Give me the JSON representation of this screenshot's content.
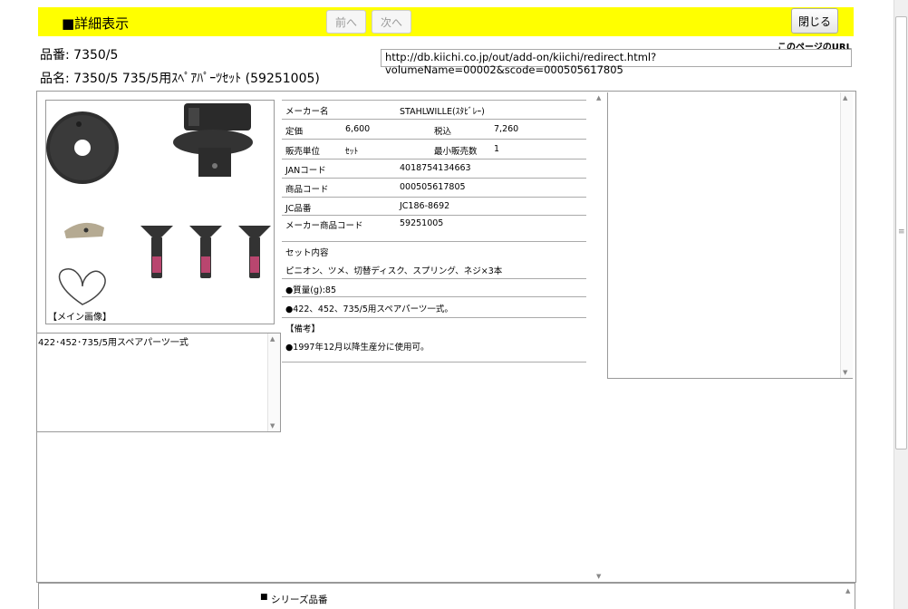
{
  "header": {
    "title": "■詳細表示",
    "prev_label": "前へ",
    "next_label": "次へ",
    "close_label": "閉じる",
    "bg_color": "#ffff00"
  },
  "product": {
    "part_number_line": "品番: 7350/5",
    "name_line": "品名: 7350/5 735/5用ｽﾍﾟｱﾊﾟｰﾂｾｯﾄ (59251005)"
  },
  "page_url": {
    "label": "このページのURL",
    "value": "http://db.kiichi.co.jp/out/add-on/kiichi/redirect.html?volumeName=00002&scode=000505617805"
  },
  "image": {
    "caption": "【メイン画像】"
  },
  "description": "422･452･735/5用スペアパーツ一式",
  "specs": {
    "maker_label": "メーカー名",
    "maker_value": "STAHLWILLE(ｽﾀﾋﾞﾚｰ)",
    "list_price_label": "定価",
    "list_price_value": "6,600",
    "tax_label": "税込",
    "tax_value": "7,260",
    "unit_label": "販売単位",
    "unit_value": "ｾｯﾄ",
    "min_label": "最小販売数",
    "min_value": "1",
    "jan_label": "JANコード",
    "jan_value": "4018754134663",
    "item_code_label": "商品コード",
    "item_code_value": "000505617805",
    "jc_label": "JC品番",
    "jc_value": "JC186-8692",
    "maker_code_label": "メーカー商品コード",
    "maker_code_value": "59251005",
    "set_label": "セット内容",
    "set_value": "ピニオン、ツメ、切替ディスク、スプリング、ネジ×3本",
    "weight": "●質量(g):85",
    "compat": "●422、452、735/5用スペアパーツ一式。",
    "remarks_label": "【備考】",
    "remarks_value": "●1997年12月以降生産分に使用可。"
  },
  "bottom": {
    "series_label": "シリーズ品番"
  }
}
